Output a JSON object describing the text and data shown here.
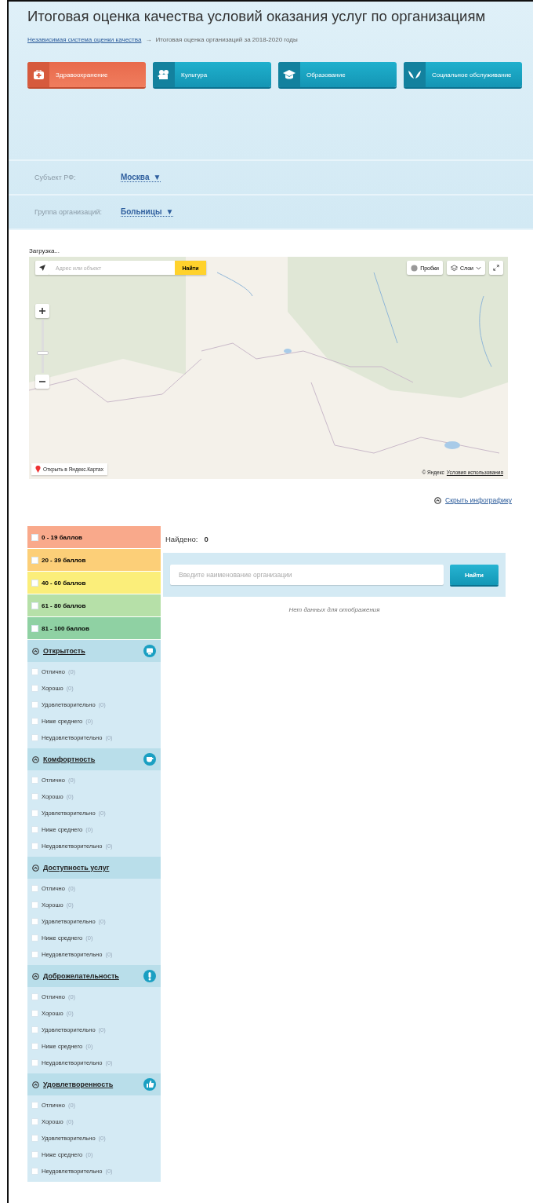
{
  "title": "Итоговая оценка качества условий оказания услуг по организациям",
  "breadcrumb": {
    "link": "Независимая система оценки качества",
    "separator": "→",
    "current": "Итоговая оценка организаций за 2018-2020 годы"
  },
  "categories": [
    {
      "label": "Здравоохранение",
      "selected": true
    },
    {
      "label": "Культура",
      "selected": false
    },
    {
      "label": "Образование",
      "selected": false
    },
    {
      "label": "Социальное обслуживание",
      "selected": false
    }
  ],
  "filters": [
    {
      "label": "Субъект РФ:",
      "value": "Москва",
      "arrow": "▼"
    },
    {
      "label": "Группа организаций:",
      "value": "Больницы",
      "arrow": "▼"
    }
  ],
  "loading": "Загрузка...",
  "map": {
    "search_placeholder": "Адрес или объект",
    "search_button": "Найти",
    "traffic": "Пробки",
    "layers": "Слои",
    "open_link": "Открыть в Яндекс.Картах",
    "zoom": {
      "level": 0.36
    },
    "copyright": "© Яндекс",
    "terms": "Условия использования"
  },
  "hide_link": "Скрыть инфографику",
  "score_ranges": [
    {
      "label": "0 - 19 баллов",
      "color": "#f9a98b",
      "checked": false
    },
    {
      "label": "20 - 39 баллов",
      "color": "#fccf78",
      "checked": false
    },
    {
      "label": "40 - 60 баллов",
      "color": "#fbee7a",
      "checked": false
    },
    {
      "label": "61 - 80 баллов",
      "color": "#b6e0a8",
      "checked": false
    },
    {
      "label": "81 - 100 баллов",
      "color": "#8fd1a3",
      "checked": false
    }
  ],
  "sections": [
    {
      "title": "Открытость",
      "expanded": true,
      "items": [
        {
          "label": "Отлично",
          "count": "(0)",
          "checked": false
        },
        {
          "label": "Хорошо",
          "count": "(0)",
          "checked": false
        },
        {
          "label": "Удовлетворительно",
          "count": "(0)",
          "checked": false
        },
        {
          "label": "Ниже среднего",
          "count": "(0)",
          "checked": false
        },
        {
          "label": "Неудовлетворительно",
          "count": "(0)",
          "checked": false
        }
      ]
    },
    {
      "title": "Комфортность",
      "expanded": true,
      "items": [
        {
          "label": "Отлично",
          "count": "(0)",
          "checked": false
        },
        {
          "label": "Хорошо",
          "count": "(0)",
          "checked": false
        },
        {
          "label": "Удовлетворительно",
          "count": "(0)",
          "checked": false
        },
        {
          "label": "Ниже среднего",
          "count": "(0)",
          "checked": false
        },
        {
          "label": "Неудовлетворительно",
          "count": "(0)",
          "checked": false
        }
      ]
    },
    {
      "title": "Доступность услуг",
      "expanded": true,
      "items": [
        {
          "label": "Отлично",
          "count": "(0)",
          "checked": false
        },
        {
          "label": "Хорошо",
          "count": "(0)",
          "checked": false
        },
        {
          "label": "Удовлетворительно",
          "count": "(0)",
          "checked": false
        },
        {
          "label": "Ниже среднего",
          "count": "(0)",
          "checked": false
        },
        {
          "label": "Неудовлетворительно",
          "count": "(0)",
          "checked": false
        }
      ]
    },
    {
      "title": "Доброжелательность",
      "expanded": true,
      "items": [
        {
          "label": "Отлично",
          "count": "(0)",
          "checked": false
        },
        {
          "label": "Хорошо",
          "count": "(0)",
          "checked": false
        },
        {
          "label": "Удовлетворительно",
          "count": "(0)",
          "checked": false
        },
        {
          "label": "Ниже среднего",
          "count": "(0)",
          "checked": false
        },
        {
          "label": "Неудовлетворительно",
          "count": "(0)",
          "checked": false
        }
      ]
    },
    {
      "title": "Удовлетворенность",
      "expanded": true,
      "items": [
        {
          "label": "Отлично",
          "count": "(0)",
          "checked": false
        },
        {
          "label": "Хорошо",
          "count": "(0)",
          "checked": false
        },
        {
          "label": "Удовлетворительно",
          "count": "(0)",
          "checked": false
        },
        {
          "label": "Ниже среднего",
          "count": "(0)",
          "checked": false
        },
        {
          "label": "Неудовлетворительно",
          "count": "(0)",
          "checked": false
        }
      ]
    }
  ],
  "results": {
    "found_label": "Найдено:",
    "found_count": "0",
    "search_placeholder": "Введите наименование организации",
    "search_button": "Найти",
    "empty": "Нет данных для отображения"
  }
}
